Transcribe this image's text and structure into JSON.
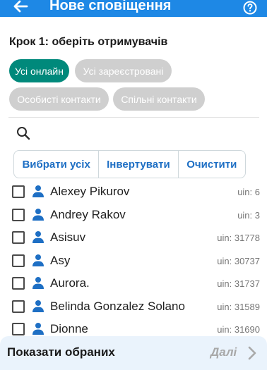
{
  "appbar": {
    "title": "Нове сповіщення",
    "back_icon": "arrow-back-icon",
    "help_icon": "help-circle-icon",
    "color": "#1e88e5"
  },
  "step": {
    "label": "Крок 1: оберіть отримувачів"
  },
  "filters": [
    {
      "label": "Усі онлайн",
      "active": true
    },
    {
      "label": "Усі зареєстровані",
      "active": false
    },
    {
      "label": "Особисті контакти",
      "active": false
    },
    {
      "label": "Спільні контакти",
      "active": false
    }
  ],
  "colors": {
    "chip_active": "#00897b",
    "chip_inactive": "#cfcfcf",
    "action_text": "#1e6fc4",
    "person_icon": "#1e6fc4"
  },
  "search": {
    "icon": "search-icon"
  },
  "actions": {
    "select_all": "Вибрати усіх",
    "invert": "Інвертувати",
    "clear": "Очистити"
  },
  "recipients": [
    {
      "name": "Alexey Pikurov",
      "uin": "uin: 6",
      "checked": false
    },
    {
      "name": "Andrey Rakov",
      "uin": "uin: 3",
      "checked": false
    },
    {
      "name": "Asisuv",
      "uin": "uin: 31778",
      "checked": false
    },
    {
      "name": "Asy",
      "uin": "uin: 30737",
      "checked": false
    },
    {
      "name": "Aurora.",
      "uin": "uin: 31737",
      "checked": false
    },
    {
      "name": "Belinda Gonzalez Solano",
      "uin": "uin: 31589",
      "checked": false
    },
    {
      "name": "Dionne",
      "uin": "uin: 31690",
      "checked": false
    }
  ],
  "bottom": {
    "show_selected": "Показати обраних",
    "next": "Далі",
    "next_icon": "chevron-right-icon"
  }
}
